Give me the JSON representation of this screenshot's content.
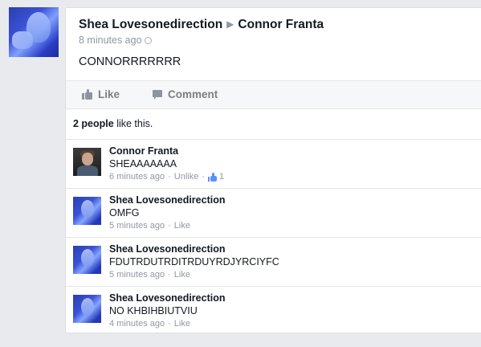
{
  "post": {
    "author": "Shea Lovesonedirection",
    "target": "Connor Franta",
    "time": "8 minutes ago",
    "body": "CONNORRRRRRR"
  },
  "actions": {
    "like": "Like",
    "comment": "Comment"
  },
  "likes": {
    "count": "2 people",
    "suffix": " like this."
  },
  "comments": [
    {
      "name": "Connor Franta",
      "text": "SHEAAAAAAA",
      "time": "6 minutes ago",
      "action": "Unlike",
      "likes": "1",
      "avatar": "connor-avatar"
    },
    {
      "name": "Shea Lovesonedirection",
      "text": "OMFG",
      "time": "5 minutes ago",
      "action": "Like",
      "avatar": "shea-avatar"
    },
    {
      "name": "Shea Lovesonedirection",
      "text": "FDUTRDUTRDITRDUYRDJYRCIYFC",
      "time": "5 minutes ago",
      "action": "Like",
      "avatar": "shea-avatar"
    },
    {
      "name": "Shea Lovesonedirection",
      "text": "NO KHBIHBIUTVIU",
      "time": "4 minutes ago",
      "action": "Like",
      "avatar": "shea-avatar"
    }
  ],
  "icons": {
    "arrow": "▶",
    "thumb": "thumbs-up-icon",
    "comment": "speech-bubble-icon",
    "globe": "globe-icon"
  },
  "colors": {
    "background": "#e9eaed",
    "meta": "#9197a3",
    "like_blue": "#5890ff"
  }
}
